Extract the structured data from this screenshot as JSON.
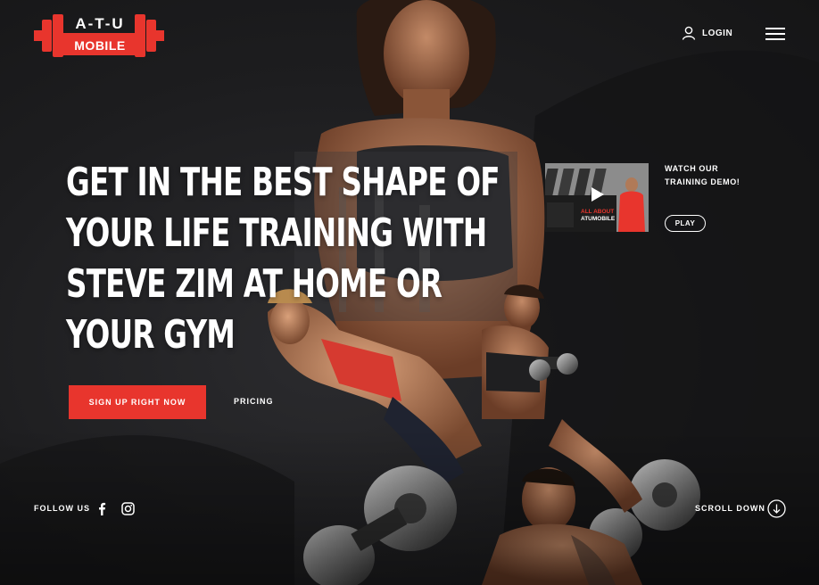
{
  "brand": {
    "line1": "A-T-U",
    "line2": "MOBILE",
    "color": "#e8352d"
  },
  "nav": {
    "login_label": "LOGIN",
    "login_icon": "user-icon",
    "menu_icon": "hamburger-menu-icon"
  },
  "hero": {
    "headline": "GET IN THE BEST SHAPE OF\nYOUR LIFE TRAINING WITH\nSTEVE ZIM AT HOME OR\nYOUR GYM",
    "cta_label": "SIGN UP RIGHT NOW",
    "pricing_label": "PRICING",
    "accent": "#e8352d"
  },
  "video": {
    "title": "WATCH OUR TRAINING DEMO!",
    "play_label": "PLAY",
    "thumb_caption_1": "ALL ABOUT",
    "thumb_caption_2": "ATUMOBILE",
    "play_icon": "play-icon"
  },
  "footer": {
    "follow_label": "FOLLOW US",
    "social": [
      "facebook-icon",
      "instagram-icon"
    ],
    "scroll_label": "SCROLL DOWN",
    "scroll_icon": "arrow-down-circle-icon"
  }
}
